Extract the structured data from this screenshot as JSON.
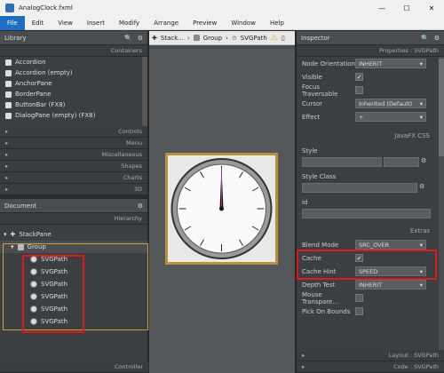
{
  "window": {
    "title": "AnalogClock.fxml"
  },
  "menu": [
    "File",
    "Edit",
    "View",
    "Insert",
    "Modify",
    "Arrange",
    "Preview",
    "Window",
    "Help"
  ],
  "library": {
    "title": "Library",
    "containers_label": "Containers",
    "items": [
      "Accordion",
      "Accordion (empty)",
      "AnchorPane",
      "BorderPane",
      "ButtonBar (FX8)",
      "DialogPane (empty) (FX8)"
    ],
    "sections": [
      "Controls",
      "Menu",
      "Miscellaneous",
      "Shapes",
      "Charts",
      "3D"
    ]
  },
  "document": {
    "title": "Document",
    "hierarchy_label": "Hierarchy",
    "tree": {
      "root": "StackPane",
      "group": "Group",
      "children": [
        "SVGPath",
        "SVGPath",
        "SVGPath",
        "SVGPath",
        "SVGPath",
        "SVGPath"
      ]
    },
    "controller_label": "Controller"
  },
  "breadcrumb": [
    "Stack...",
    "Group",
    "SVGPath"
  ],
  "inspector": {
    "title": "Inspector",
    "properties_label": "Properties : SVGPath",
    "node_orientation": {
      "label": "Node Orientation",
      "value": "INHERIT"
    },
    "visible": {
      "label": "Visible",
      "checked": true
    },
    "focus_traversable": {
      "label": "Focus Traversable",
      "checked": false
    },
    "cursor": {
      "label": "Cursor",
      "value": "Inherited (Default)"
    },
    "effect": {
      "label": "Effect",
      "value": "+"
    },
    "javafx_css_label": "JavaFX CSS",
    "style_label": "Style",
    "style_class_label": "Style Class",
    "id_label": "id",
    "extras_label": "Extras",
    "blend_mode": {
      "label": "Blend Mode",
      "value": "SRC_OVER"
    },
    "cache": {
      "label": "Cache",
      "checked": true
    },
    "cache_hint": {
      "label": "Cache Hint",
      "value": "SPEED"
    },
    "depth_test": {
      "label": "Depth Test",
      "value": "INHERIT"
    },
    "mouse_transparent": {
      "label": "Mouse Transpare...",
      "checked": false
    },
    "pick_on_bounds": {
      "label": "Pick On Bounds",
      "checked": false
    },
    "layout_label": "Layout : SVGPath",
    "code_label": "Code : SVGPath"
  },
  "colors": {
    "accent": "#1e6fc0",
    "highlight": "#e01818",
    "selection": "#c8a13a"
  }
}
